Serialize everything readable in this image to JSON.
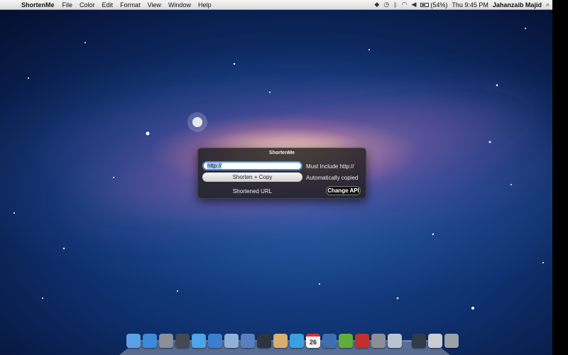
{
  "menubar": {
    "app_name": "ShortenMe",
    "menus": [
      "File",
      "Color",
      "Edit",
      "Format",
      "View",
      "Window",
      "Help"
    ],
    "battery": "(54%)",
    "clock": "Thu 9:45 PM",
    "user": "Jahanzaib Majid"
  },
  "hud": {
    "title": "ShortenMe",
    "url_value": "http://",
    "url_hint": "Must Include http://",
    "shorten_button": "Shorten + Copy",
    "copy_hint": "Automatically copied",
    "result_label": "Shortened URL",
    "change_api_button": "Change API"
  },
  "dock": {
    "calendar_day": "26",
    "icons": [
      {
        "name": "finder-icon",
        "color": "#5aa0e6"
      },
      {
        "name": "app-store-icon",
        "color": "#3b8bd9"
      },
      {
        "name": "launchpad-icon",
        "color": "#8a8f98"
      },
      {
        "name": "mission-control-icon",
        "color": "#444a52"
      },
      {
        "name": "messages-icon",
        "color": "#4fa3e8"
      },
      {
        "name": "safari-icon",
        "color": "#3a7fd0"
      },
      {
        "name": "mail-icon",
        "color": "#8fb0d8"
      },
      {
        "name": "xcode-icon",
        "color": "#5a7fbf"
      },
      {
        "name": "quicktime-icon",
        "color": "#2c3440"
      },
      {
        "name": "preview-icon",
        "color": "#d8b070"
      },
      {
        "name": "tweetbot-icon",
        "color": "#3aa0e0"
      },
      {
        "name": "calendar-icon",
        "color": "#f4f4f4"
      },
      {
        "name": "pencil-app-icon",
        "color": "#3c6fb0"
      },
      {
        "name": "evernote-icon",
        "color": "#5fae3c"
      },
      {
        "name": "photo-booth-icon",
        "color": "#c0302c"
      },
      {
        "name": "system-preferences-icon",
        "color": "#8c9096"
      },
      {
        "name": "link-app-icon",
        "color": "#b8c4d0"
      },
      {
        "name": "lock-app-icon",
        "color": "#2f3b48"
      },
      {
        "name": "documents-folder-icon",
        "color": "#c9cdd3"
      },
      {
        "name": "trash-icon",
        "color": "#9aa2ab"
      }
    ]
  }
}
